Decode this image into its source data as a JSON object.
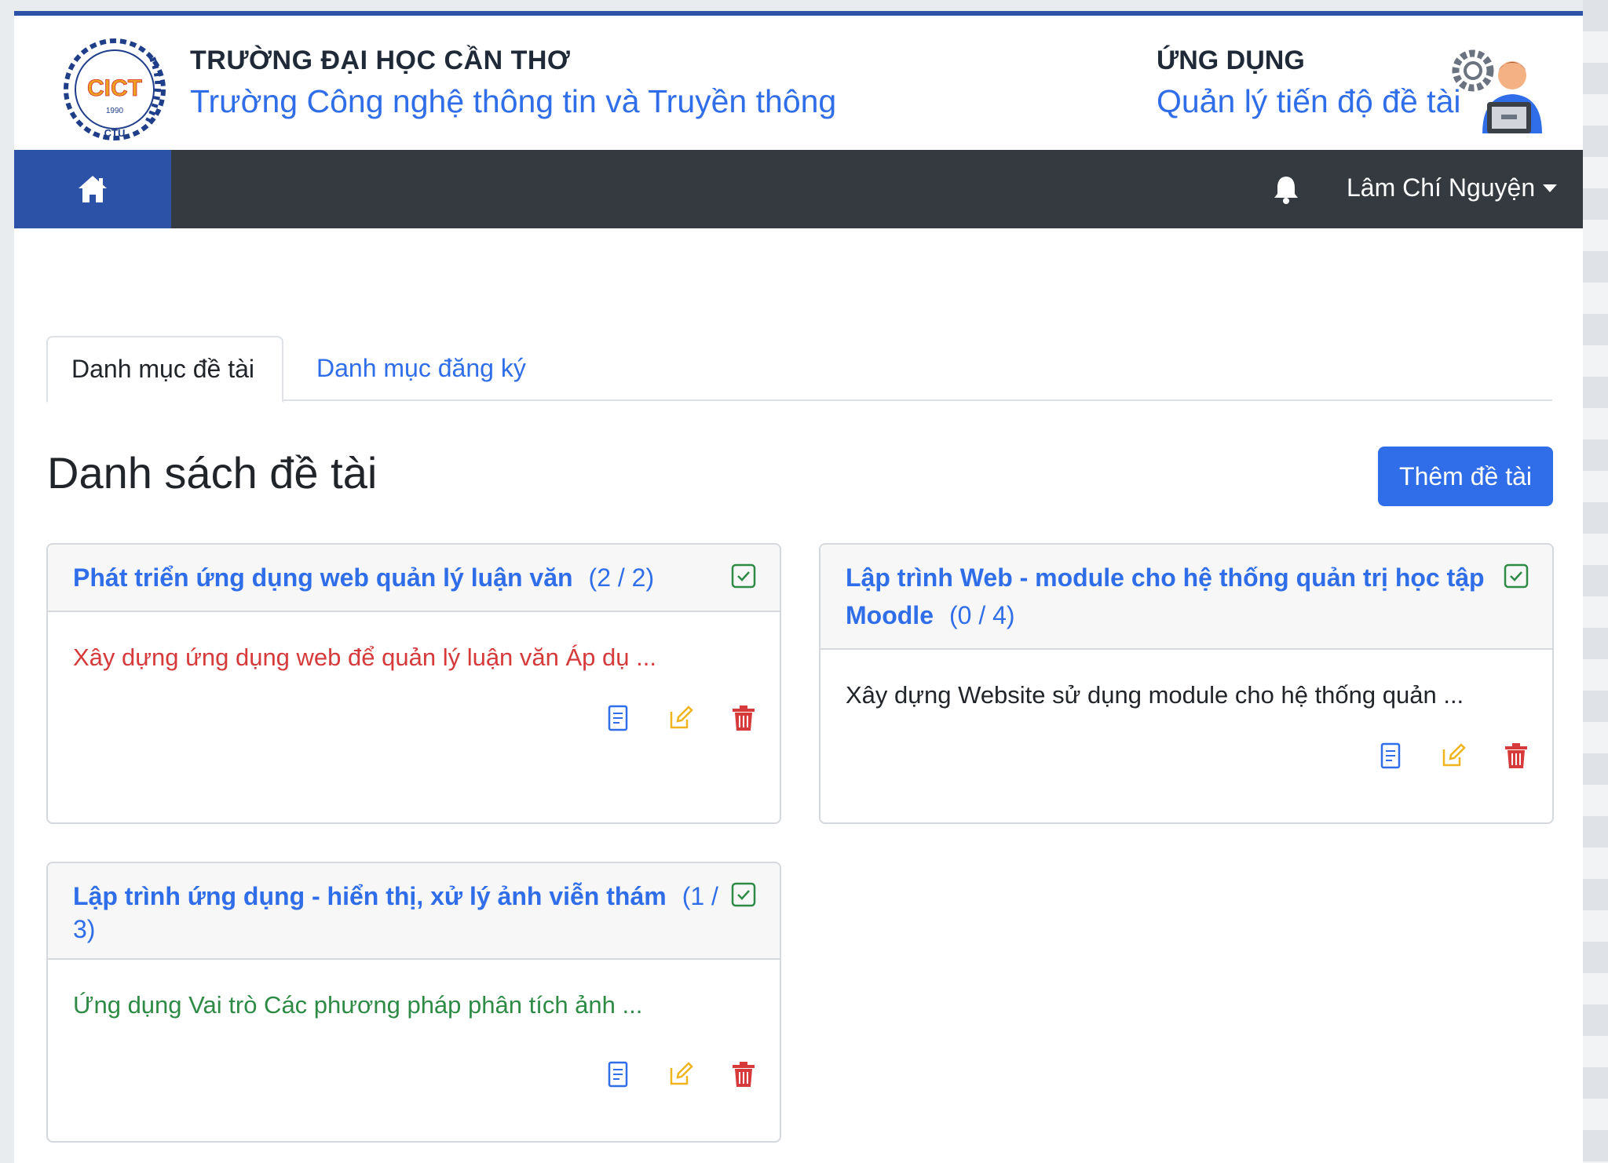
{
  "header": {
    "school_title": "TRƯỜNG ĐẠI HỌC CẦN THƠ",
    "school_subtitle": "Trường Công nghệ thông tin và Truyền thông",
    "app_title": "ỨNG DỤNG",
    "app_subtitle": "Quản lý tiến độ đề tài",
    "logo": {
      "text": "CICT",
      "year": "1990",
      "bottom": "CTU"
    }
  },
  "navbar": {
    "home_icon": "home-icon",
    "bell_icon": "bell-icon",
    "user_name": "Lâm Chí Nguyện"
  },
  "tabs": [
    {
      "label": "Danh mục đề tài",
      "active": true
    },
    {
      "label": "Danh mục đăng ký",
      "active": false
    }
  ],
  "main": {
    "title": "Danh sách đề tài",
    "add_button": "Thêm đề tài"
  },
  "cards": [
    {
      "title": "Phát triển ứng dụng web quản lý luận văn",
      "count": "(2 / 2)",
      "description": "Xây dựng ứng dụng web để quản lý luận văn Áp dụ ...",
      "desc_color": "#d63a3a"
    },
    {
      "title": "Lập trình Web - module cho hệ thống quản trị học tập Moodle",
      "count": "(0 / 4)",
      "description": "Xây dựng Website sử dụng module cho hệ thống quản ...",
      "desc_color": "#212529"
    },
    {
      "title": "Lập trình ứng dụng - hiển thị, xử lý ảnh viễn thám",
      "count": "(1 / 3)",
      "description": "Ứng dụng Vai trò Các phương pháp phân tích ảnh ...",
      "desc_color": "#2e8b45"
    }
  ],
  "colors": {
    "primary": "#2f6ee8",
    "navbar": "#343a40",
    "home_bg": "#2c52a8",
    "edit_icon": "#f0b41c",
    "delete_icon": "#d63a3a",
    "check_icon": "#2e8b45"
  }
}
